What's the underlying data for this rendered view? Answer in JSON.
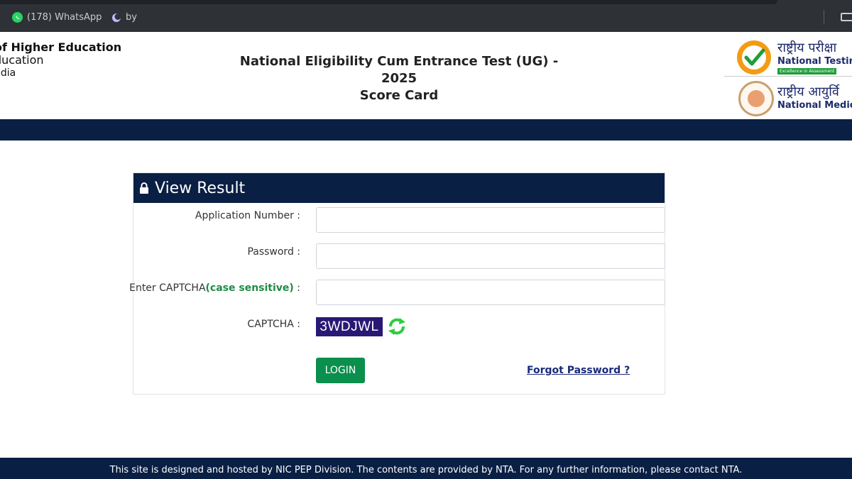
{
  "browser": {
    "bookmarks": [
      {
        "label": "(178) WhatsApp",
        "icon": "whatsapp-icon"
      },
      {
        "label": "by",
        "icon": "crescent-icon"
      }
    ]
  },
  "header": {
    "ministry_line1": "of Higher Education",
    "ministry_line2": "ducation",
    "ministry_line3": "ndia",
    "title_line1": "National Eligibility Cum Entrance Test (UG) - 2025",
    "title_line2": "Score Card",
    "nta_hindi": "राष्ट्रीय परीक्षा",
    "nta_english": "National Testing",
    "nta_tagline": "Excellence in Assessment",
    "nmc_hindi": "राष्ट्रीय आयुर्वि",
    "nmc_english": "National Medica"
  },
  "form": {
    "heading": "View Result",
    "application_number_label": "Application Number :",
    "application_number_value": "",
    "password_label": "Password :",
    "password_value": "",
    "captcha_input_label_prefix": "Enter CAPTCHA",
    "captcha_input_label_note": "(case sensitive)",
    "captcha_input_label_suffix": " :",
    "captcha_input_value": "",
    "captcha_label": "CAPTCHA :",
    "captcha_text": "3WDJWL",
    "login_button": "LOGIN",
    "forgot_password": "Forgot Password ?"
  },
  "footer": {
    "text": "This site is designed and hosted by NIC PEP Division. The contents are provided by NTA. For any further information, please contact NTA."
  },
  "colors": {
    "navy": "#0a1f44",
    "login_green": "#0a8f4d",
    "captcha_bg": "#2a1875",
    "note_green": "#1e8c45"
  }
}
